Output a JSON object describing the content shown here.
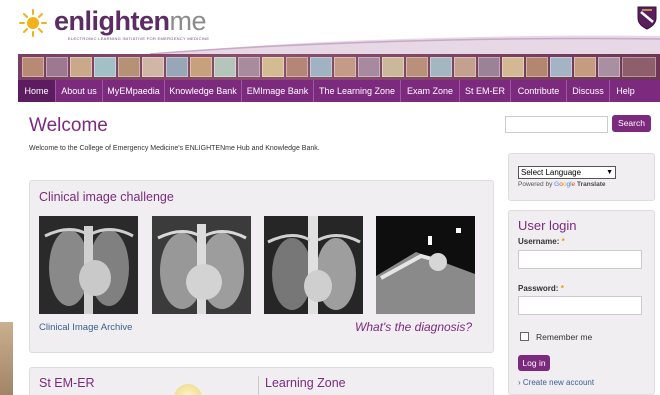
{
  "header": {
    "logo_main": "enlighten",
    "logo_suffix": "me",
    "tagline": "ELECTRONIC LEARNING INITIATIVE FOR EMERGENCY MEDICINE"
  },
  "nav": {
    "items": [
      {
        "label": "Home",
        "active": true
      },
      {
        "label": "About us"
      },
      {
        "label": "MyEMpaedia"
      },
      {
        "label": "Knowledge Bank"
      },
      {
        "label": "EMImage Bank"
      },
      {
        "label": "The Learning Zone"
      },
      {
        "label": "Exam Zone"
      },
      {
        "label": "St EM-ER"
      },
      {
        "label": "Contribute"
      },
      {
        "label": "Discuss"
      },
      {
        "label": "Help"
      }
    ]
  },
  "main": {
    "title": "Welcome",
    "intro": "Welcome to the College of Emergency Medicine's ENLIGHTENme Hub and Knowledge Bank.",
    "challenge": {
      "title": "Clinical image challenge",
      "archive_link": "Clinical Image Archive",
      "diagnosis_link": "What's the diagnosis?"
    },
    "bottom_panels": {
      "left_title": "St EM-ER",
      "right_title": "Learning Zone"
    }
  },
  "sidebar": {
    "search": {
      "value": "",
      "button": "Search"
    },
    "translate": {
      "select_value": "Select Language",
      "powered_prefix": "Powered by",
      "google": [
        "G",
        "o",
        "o",
        "g",
        "l",
        "e"
      ],
      "powered_suffix": "Translate"
    },
    "login": {
      "title": "User login",
      "username_label": "Username:",
      "password_label": "Password:",
      "required_mark": "*",
      "remember_label": "Remember me",
      "login_button": "Log in",
      "create_link": "Create new account"
    }
  },
  "colors": {
    "brand_purple": "#7c2a7e",
    "nav_active": "#5d1c60",
    "link_blue": "#3a5f8f"
  }
}
